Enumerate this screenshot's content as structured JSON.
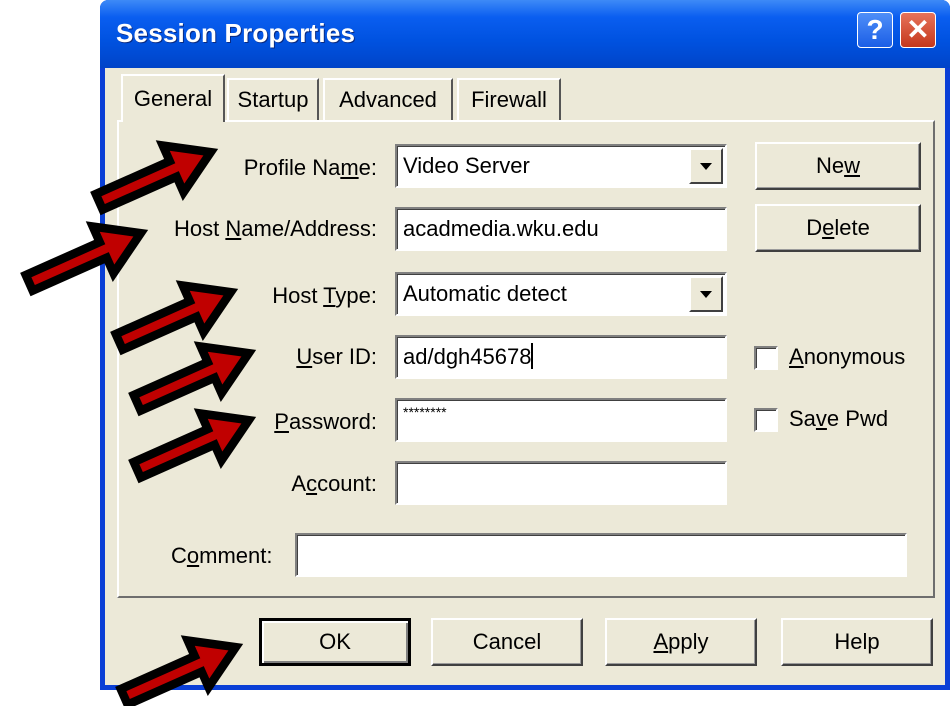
{
  "window": {
    "title": "Session Properties",
    "help_glyph": "?",
    "close_glyph": "✕"
  },
  "tabs": [
    {
      "label": "General",
      "active": true
    },
    {
      "label": "Startup",
      "active": false
    },
    {
      "label": "Advanced",
      "active": false
    },
    {
      "label": "Firewall",
      "active": false
    }
  ],
  "form": {
    "profile_name": {
      "label_pre": "Profile Na",
      "label_u": "m",
      "label_post": "e:",
      "value": "Video Server"
    },
    "host_name": {
      "label_pre": "Host ",
      "label_u": "N",
      "label_post": "ame/Address:",
      "value": "acadmedia.wku.edu"
    },
    "host_type": {
      "label_pre": "Host ",
      "label_u": "T",
      "label_post": "ype:",
      "value": "Automatic detect"
    },
    "user_id": {
      "label_pre": "",
      "label_u": "U",
      "label_post": "ser ID:",
      "value": "ad/dgh45678"
    },
    "password": {
      "label_pre": "",
      "label_u": "P",
      "label_post": "assword:",
      "value": "********"
    },
    "account": {
      "label_pre": "A",
      "label_u": "c",
      "label_post": "count:",
      "value": ""
    },
    "comment": {
      "label_pre": "C",
      "label_u": "o",
      "label_post": "mment:",
      "value": ""
    }
  },
  "side_buttons": {
    "new": {
      "pre": "Ne",
      "u": "w",
      "post": ""
    },
    "delete": {
      "pre": "D",
      "u": "e",
      "post": "lete"
    }
  },
  "checkboxes": {
    "anonymous": {
      "pre": "",
      "u": "A",
      "post": "nonymous",
      "checked": false
    },
    "save_pwd": {
      "pre": "Sa",
      "u": "v",
      "post": "e Pwd",
      "checked": false
    }
  },
  "bottom_buttons": {
    "ok": "OK",
    "cancel": "Cancel",
    "apply": {
      "pre": "",
      "u": "A",
      "post": "pply"
    },
    "help": "Help"
  },
  "colors": {
    "titlebar": "#0052e0",
    "dialog_bg": "#ece9d8",
    "arrow_fill": "#c00000",
    "arrow_outline": "#000000"
  }
}
